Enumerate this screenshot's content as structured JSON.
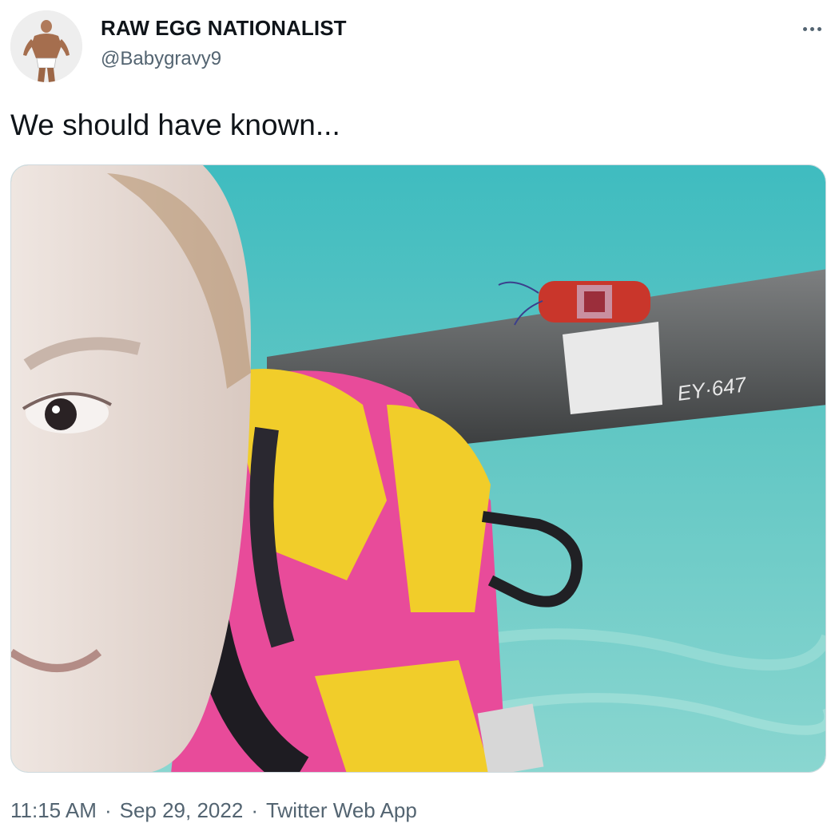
{
  "author": {
    "display_name": "RAW EGG NATIONALIST",
    "handle": "@Babygravy9",
    "avatar_icon": "bodybuilder-avatar-icon"
  },
  "more_icon": "more-options-icon",
  "tweet": {
    "text": "We should have known..."
  },
  "media": {
    "pipe_marking": "EY·647"
  },
  "meta": {
    "time": "11:15 AM",
    "date": "Sep 29, 2022",
    "source": "Twitter Web App",
    "separator": "·"
  },
  "colors": {
    "text_primary": "#0f1419",
    "text_secondary": "#536471",
    "border": "#cfd9de",
    "water": "#5ec4c4"
  }
}
